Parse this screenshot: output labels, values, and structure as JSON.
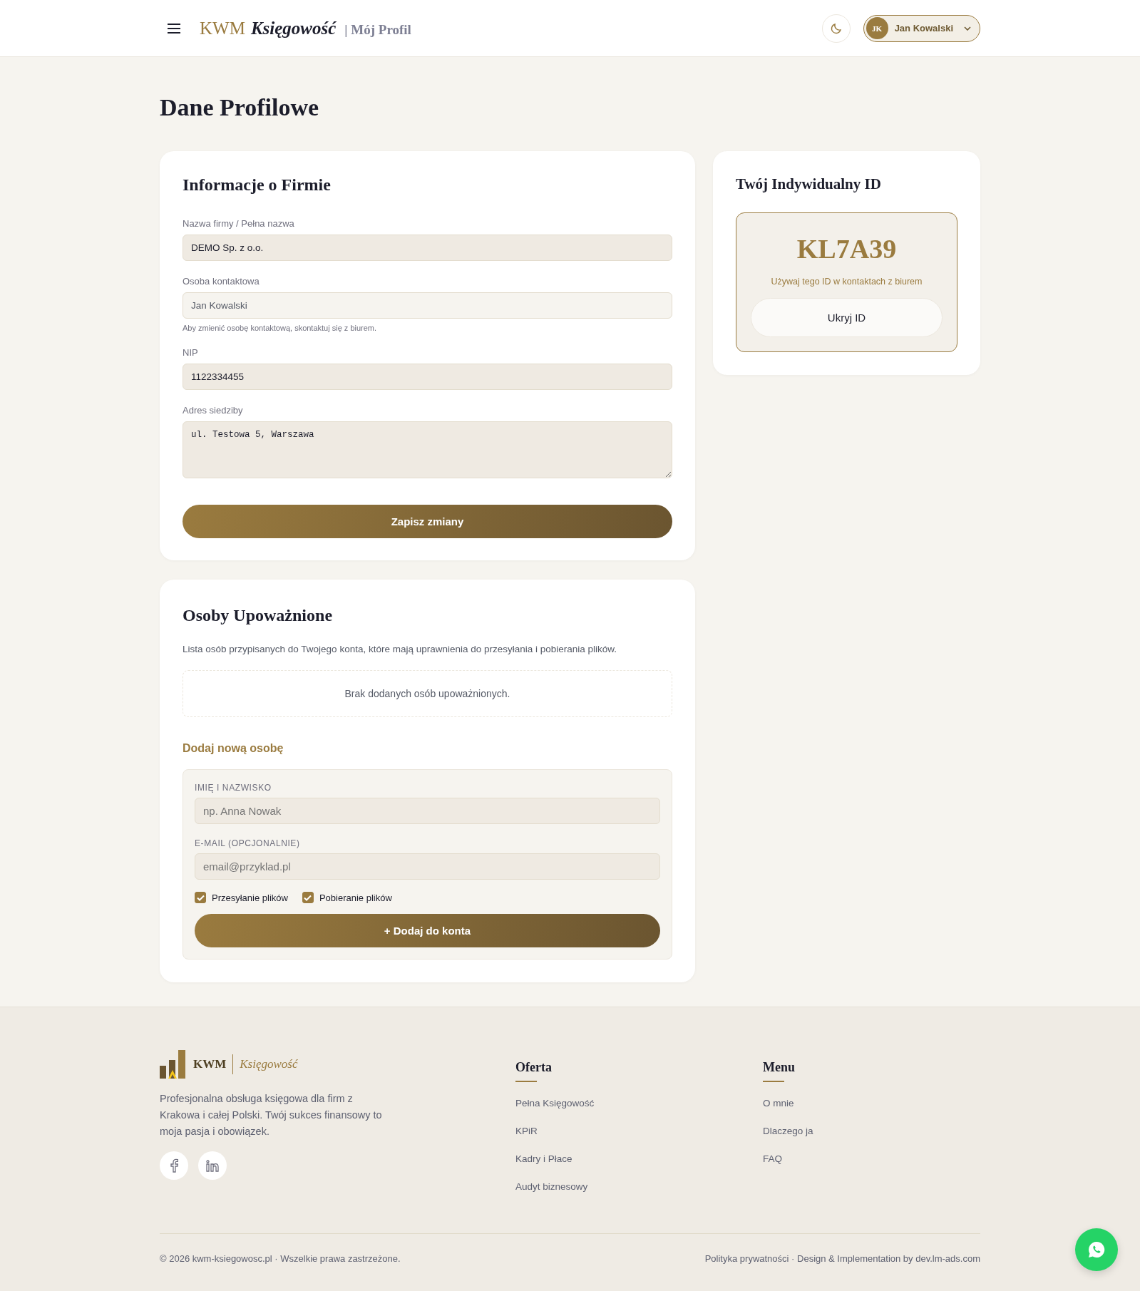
{
  "header": {
    "brand_primary": "KWM",
    "brand_secondary": "Księgowość",
    "page_label": "| Mój Profil",
    "user": {
      "initials": "JK",
      "name": "Jan Kowalski"
    }
  },
  "page_title": "Dane Profilowe",
  "company": {
    "title": "Informacje o Firmie",
    "fields": [
      {
        "kind": "input",
        "label": "Nazwa firmy / Pełna nazwa",
        "value": "DEMO Sp. z o.o.",
        "disabled": false
      },
      {
        "kind": "input",
        "label": "Osoba kontaktowa",
        "value": "Jan Kowalski",
        "disabled": true,
        "hint": "Aby zmienić osobę kontaktową, skontaktuj się z biurem."
      },
      {
        "kind": "input",
        "label": "NIP",
        "value": "1122334455",
        "disabled": false
      },
      {
        "kind": "textarea",
        "label": "Adres siedziby",
        "value": "ul. Testowa 5, Warszawa",
        "disabled": false
      }
    ],
    "save_button": "Zapisz zmiany"
  },
  "id_card": {
    "title": "Twój Indywidualny ID",
    "id_value": "KL7A39",
    "hint": "Używaj tego ID w kontaktach z biurem",
    "hide_button": "Ukryj ID"
  },
  "authorized": {
    "title": "Osoby Upoważnione",
    "description": "Lista osób przypisanych do Twojego konta, które mają uprawnienia do przesyłania i pobierania plików.",
    "empty_message": "Brak dodanych osób upoważnionych.",
    "add_form": {
      "title": "Dodaj nową osobę",
      "fields": [
        {
          "label": "IMIĘ I NAZWISKO",
          "placeholder": "np. Anna Nowak"
        },
        {
          "label": "E-MAIL (OPCJONALNIE)",
          "placeholder": "email@przyklad.pl"
        }
      ],
      "permissions": [
        {
          "label": "Przesyłanie plików",
          "checked": true
        },
        {
          "label": "Pobieranie plików",
          "checked": true
        }
      ],
      "add_button": "+ Dodaj do konta"
    }
  },
  "footer": {
    "brand_primary": "KWM",
    "brand_secondary": "Księgowość",
    "description": "Profesjonalna obsługa księgowa dla firm z Krakowa i całej Polski. Twój sukces finansowy to moja pasja i obowiązek.",
    "columns": [
      {
        "title": "Oferta",
        "links": [
          "Pełna Księgowość",
          "KPiR",
          "Kadry i Płace",
          "Audyt biznesowy"
        ]
      },
      {
        "title": "Menu",
        "links": [
          "O mnie",
          "Dlaczego ja",
          "FAQ"
        ]
      }
    ],
    "copyright": "© 2026 kwm-ksiegowosc.pl · Wszelkie prawa zastrzeżone.",
    "credits": "Polityka prywatności · Design & Implementation by dev.lm-ads.com"
  }
}
